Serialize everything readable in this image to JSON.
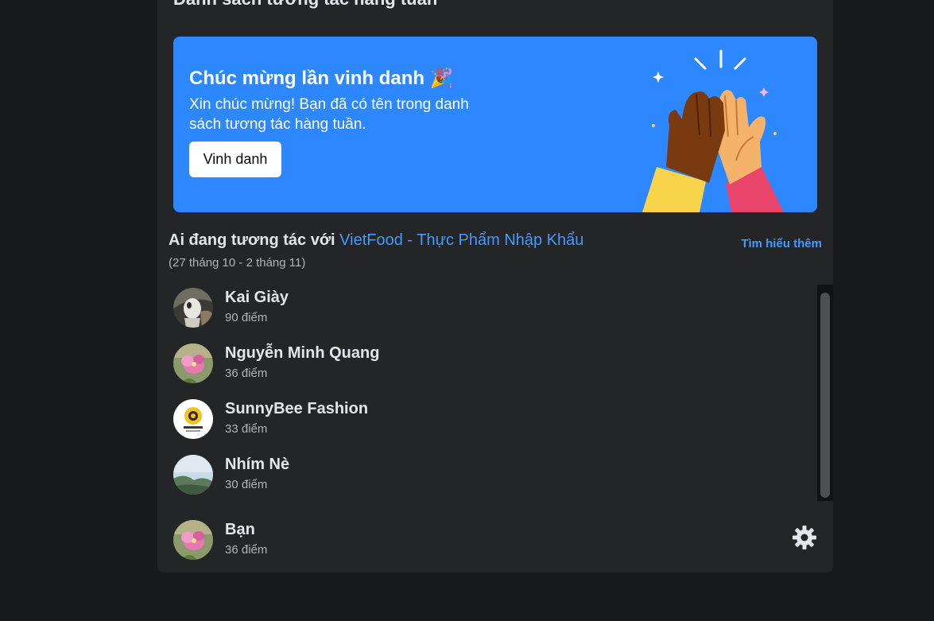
{
  "card": {
    "title": "Danh sách tương tác hàng tuần"
  },
  "banner": {
    "title": "Chúc mừng lần vinh danh 🎉",
    "text": "Xin chúc mừng! Bạn đã có tên trong danh sách tương tác hàng tuần.",
    "button_label": "Vinh danh",
    "illustration": "high-five-illustration",
    "color": "#2d88ff"
  },
  "section": {
    "heading_prefix": "Ai đang tương tác với ",
    "page_name": "VietFood - Thực Phẩm Nhập Khẩu",
    "date_range": "(27 tháng 10 - 2 tháng 11)",
    "learn_more": "Tìm hiểu thêm"
  },
  "members": [
    {
      "name": "Kai Giày",
      "score": "90 điểm",
      "avatar": "dog-photo"
    },
    {
      "name": "Nguyễn Minh Quang",
      "score": "36 điểm",
      "avatar": "pink-flower-photo"
    },
    {
      "name": "SunnyBee Fashion",
      "score": "33 điểm",
      "avatar": "sunnybee-logo"
    },
    {
      "name": "Nhím Nè",
      "score": "30 điểm",
      "avatar": "landscape-photo"
    }
  ],
  "me": {
    "name": "Bạn",
    "score": "36 điểm",
    "avatar": "pink-flower-photo",
    "settings_icon": "gear-icon"
  },
  "colors": {
    "background": "#18191a",
    "card": "#242526",
    "link": "#4599ff",
    "secondary_text": "#b0b3b8"
  }
}
